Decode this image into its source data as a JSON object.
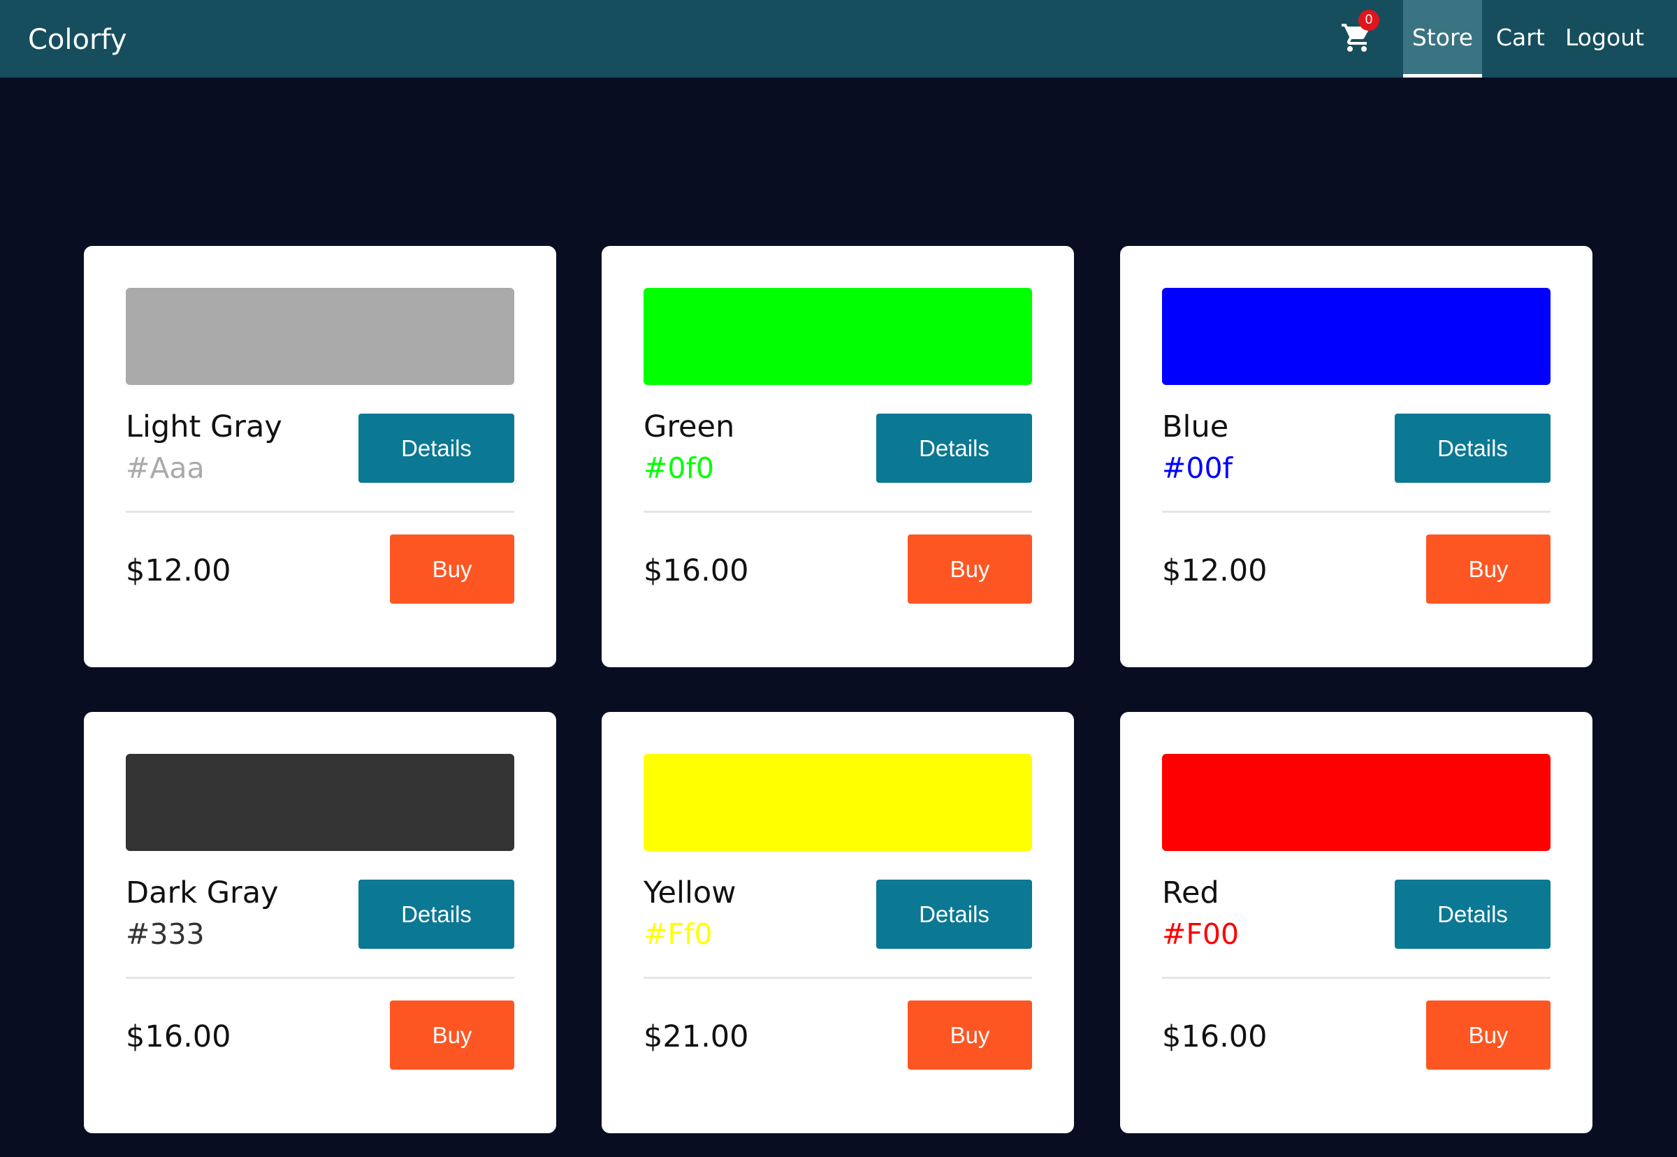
{
  "app": {
    "brand": "Colorfy",
    "cart_count": "0",
    "nav": {
      "store": "Store",
      "cart": "Cart",
      "logout": "Logout"
    }
  },
  "products": [
    {
      "name": "Light Gray",
      "hex": "#Aaa",
      "color": "#aaaaaa",
      "price": "$12.00",
      "details_label": "Details",
      "buy_label": "Buy"
    },
    {
      "name": "Green",
      "hex": "#0f0",
      "color": "#00ff00",
      "price": "$16.00",
      "details_label": "Details",
      "buy_label": "Buy"
    },
    {
      "name": "Blue",
      "hex": "#00f",
      "color": "#0000ff",
      "price": "$12.00",
      "details_label": "Details",
      "buy_label": "Buy"
    },
    {
      "name": "Dark Gray",
      "hex": "#333",
      "color": "#333333",
      "price": "$16.00",
      "details_label": "Details",
      "buy_label": "Buy"
    },
    {
      "name": "Yellow",
      "hex": "#Ff0",
      "color": "#ffff00",
      "price": "$21.00",
      "details_label": "Details",
      "buy_label": "Buy"
    },
    {
      "name": "Red",
      "hex": "#F00",
      "color": "#ff0000",
      "price": "$16.00",
      "details_label": "Details",
      "buy_label": "Buy"
    }
  ],
  "colors": {
    "header_bg": "#164e5e",
    "page_bg": "#080d21",
    "details_button": "#0b7894",
    "buy_button": "#fd5623",
    "badge": "#e0161d"
  }
}
